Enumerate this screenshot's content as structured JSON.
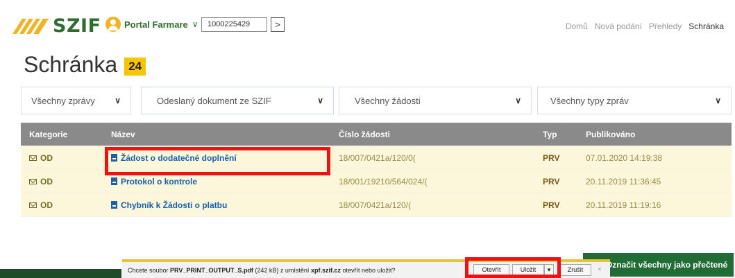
{
  "header": {
    "logo_text": "SZIF",
    "portal_label": "Portal Farmare",
    "portal_chevron": "∨",
    "id_value": "1000225429",
    "go_label": ">",
    "nav": [
      "Domů",
      "Nová podání",
      "Přehledy",
      "Schránka"
    ],
    "active_nav": "Schránka"
  },
  "page": {
    "title": "Schránka",
    "badge": "24"
  },
  "filters": [
    {
      "label": "Všechny zprávy",
      "caret": "∨"
    },
    {
      "label": "Odeslaný dokument ze SZIF",
      "caret": "∨"
    },
    {
      "label": "Všechny žádosti",
      "caret": "∨"
    },
    {
      "label": "Všechny typy zpráv",
      "caret": "∨"
    }
  ],
  "table": {
    "columns": [
      "Kategorie",
      "Název",
      "Číslo žádosti",
      "Typ",
      "Publikováno"
    ],
    "rows": [
      {
        "category": "OD",
        "name": "Žádost o dodatečné doplnění",
        "number": "18/007/0421a/120/0(",
        "type": "PRV",
        "published": "07.01.2020 14:19:38"
      },
      {
        "category": "OD",
        "name": "Protokol o kontrole",
        "number": "18/001/19210/564/024/(",
        "type": "PRV",
        "published": "20.11.2019 11:36:45"
      },
      {
        "category": "OD",
        "name": "Chybník k Žádosti o platbu",
        "number": "18/007/0421a/120/(",
        "type": "PRV",
        "published": "20.11.2019 11:19:16"
      }
    ]
  },
  "actions": {
    "mark_all_read": "Označit všechny jako přečtené",
    "mark_icon": "send-arrow-icon"
  },
  "download_bar": {
    "prefix": "Chcete soubor ",
    "filename": "PRV_PRINT_OUTPUT_S.pdf",
    "size": " (242 kB) z umístění ",
    "host": "xpf.szif.cz",
    "suffix": " otevřít nebo uložit?",
    "open_label": "Otevřít",
    "save_label": "Uložit",
    "save_dropdown": "▾",
    "cancel_label": "Zrušit",
    "close_label": "×"
  },
  "colors": {
    "brand_green": "#2e6d2f",
    "badge_yellow": "#f6c400",
    "row_bg": "#fcf6da",
    "link_blue": "#1a5fa8",
    "highlight_red": "#e11"
  }
}
